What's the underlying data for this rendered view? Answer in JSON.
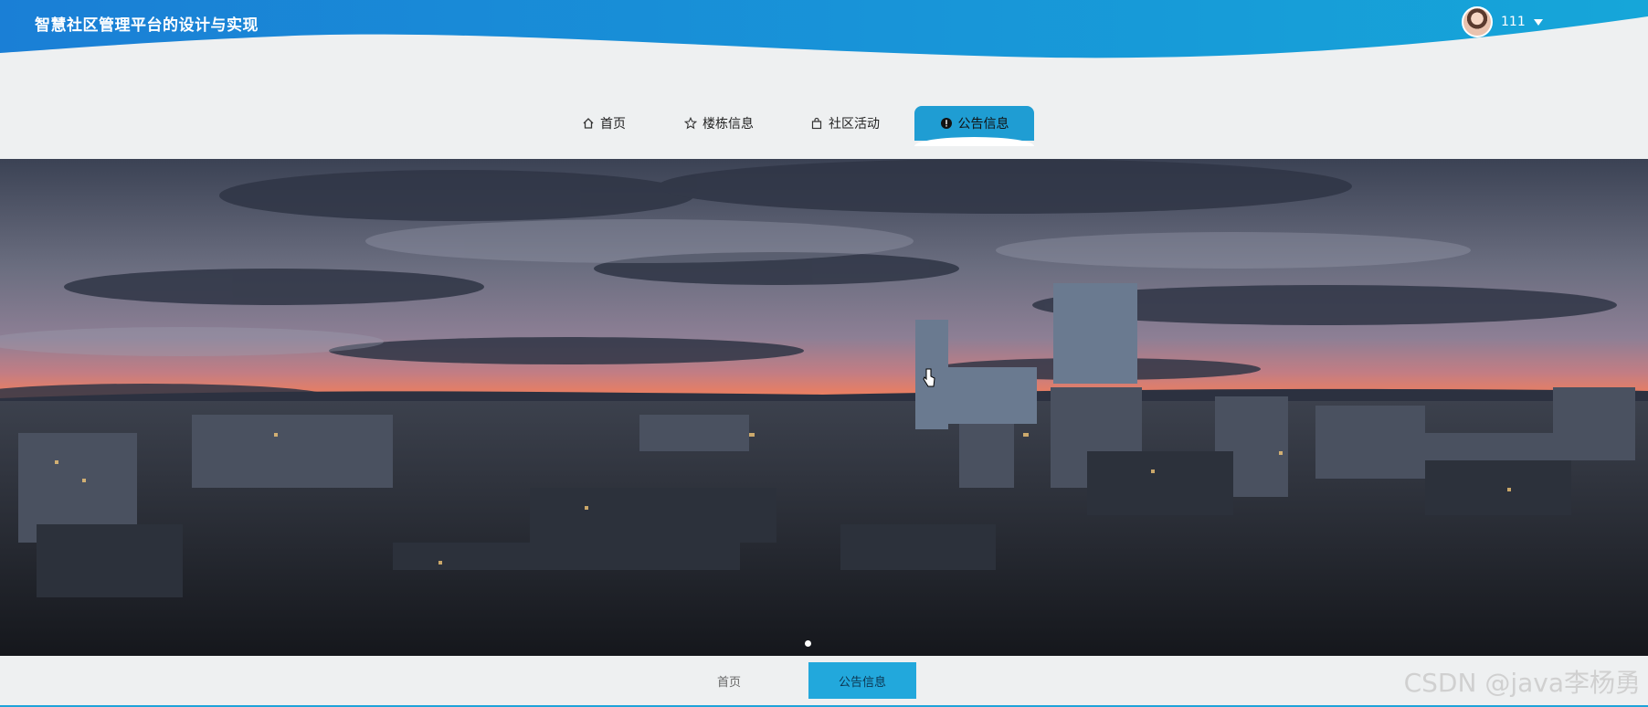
{
  "header": {
    "site_title": "智慧社区管理平台的设计与实现",
    "user_name": "111"
  },
  "nav": [
    {
      "label": "首页",
      "icon": "home-icon"
    },
    {
      "label": "楼栋信息",
      "icon": "star-icon"
    },
    {
      "label": "社区活动",
      "icon": "bag-icon"
    },
    {
      "label": "公告信息",
      "icon": "alert-circle-icon",
      "active": true
    }
  ],
  "carousel": {
    "image": "city skyline at sunset banner",
    "dots": 1
  },
  "breadcrumb": [
    {
      "label": "首页"
    },
    {
      "label": "公告信息",
      "active": true
    }
  ],
  "watermark": "CSDN @java李杨勇",
  "colors": {
    "header_left": "#1a7fd6",
    "header_right": "#16a6d9",
    "accent": "#1f9dd3",
    "page_bg": "#eef0f1"
  }
}
